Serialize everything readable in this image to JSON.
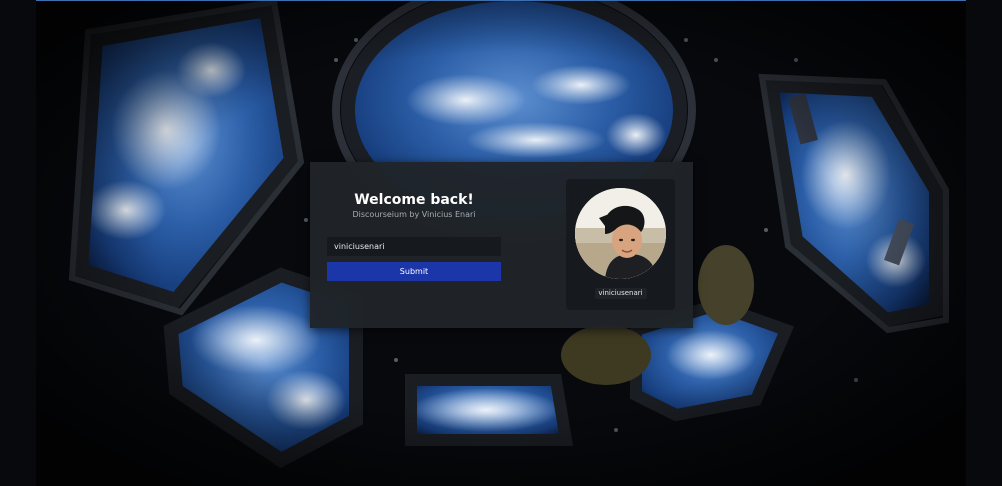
{
  "login": {
    "title": "Welcome back!",
    "subtitle": "Discourseium by Vinicius Enari",
    "username_value": "viniciusenari",
    "submit_label": "Submit"
  },
  "profile": {
    "username": "viniciusenari"
  },
  "colors": {
    "card_background": "#202429",
    "input_background": "#16191d",
    "submit_button": "#1b36a8",
    "title_text": "#ffffff",
    "subtitle_text": "#a7adb5"
  }
}
